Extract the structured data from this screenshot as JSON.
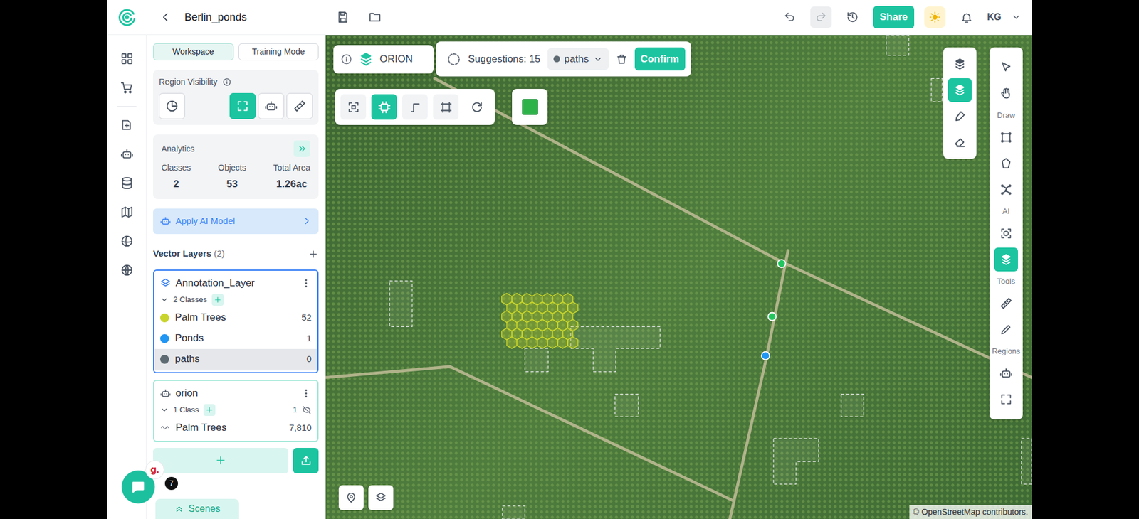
{
  "app": {
    "title": "Berlin_ponds",
    "user": "KG"
  },
  "history": {
    "undo": {
      "disabled": false
    },
    "redo": {
      "disabled": true
    }
  },
  "share": {
    "label": "Share"
  },
  "modes": [
    {
      "label": "Workspace",
      "selected": true
    },
    {
      "label": "Training Mode",
      "selected": false
    }
  ],
  "region_visibility": {
    "title": "Region Visibility",
    "buttons": [
      {
        "selected": false
      },
      {
        "selected": true
      },
      {
        "selected": false
      },
      {
        "selected": false
      }
    ]
  },
  "analytics": {
    "title": "Analytics",
    "stats": [
      {
        "label": "Classes",
        "value": "2"
      },
      {
        "label": "Objects",
        "value": "53"
      },
      {
        "label": "Total Area",
        "value": "1.26ac"
      }
    ]
  },
  "apply_model": {
    "label": "Apply AI Model"
  },
  "vector_layers": {
    "title": "Vector Layers",
    "count": "(2)",
    "layers": [
      {
        "name": "Annotation_Layer",
        "kind": "annotation",
        "selected": true,
        "classes_label": "2 Classes",
        "expanded": true,
        "classes": [
          {
            "name": "Palm Trees",
            "count": "52",
            "color": "#c8d42b",
            "selected": false
          },
          {
            "name": "Ponds",
            "count": "1",
            "color": "#2196f3",
            "selected": false
          },
          {
            "name": "paths",
            "count": "0",
            "color": "#5f6b73",
            "selected": true
          }
        ]
      },
      {
        "name": "orion",
        "kind": "model",
        "selected": false,
        "classes_label": "1 Class",
        "expanded": true,
        "visible_count": "1",
        "hidden": true,
        "classes": [
          {
            "name": "Palm Trees",
            "count": "7,810",
            "selected": false
          }
        ]
      }
    ]
  },
  "chat": {
    "logo": "g.",
    "unread": "7"
  },
  "scenes": {
    "label": "Scenes"
  },
  "map": {
    "orion": {
      "label": "ORION"
    },
    "suggestions": {
      "label": "Suggestions: 15",
      "class_name": "paths",
      "class_color": "#5f6b73",
      "confirm": "Confirm"
    },
    "tools": [
      {
        "selected": false
      },
      {
        "selected": true
      },
      {
        "selected": false
      },
      {
        "selected": false
      },
      {
        "selected": false
      }
    ],
    "swatch": {
      "color": "#2db24a"
    },
    "mini_tools": [
      {
        "selected": false
      },
      {
        "selected": true
      },
      {
        "selected": false
      },
      {
        "selected": false
      }
    ],
    "toolbar_top": [
      {
        "selected": false
      },
      {
        "selected": false
      }
    ],
    "toolbar_sections": [
      {
        "label": "Draw",
        "tools": [
          {
            "selected": false
          },
          {
            "selected": false
          },
          {
            "selected": false
          }
        ]
      },
      {
        "label": "AI",
        "tools": [
          {
            "selected": false
          },
          {
            "selected": true
          }
        ]
      },
      {
        "label": "Tools",
        "tools": [
          {
            "selected": false
          },
          {
            "selected": false
          }
        ]
      },
      {
        "label": "Regions",
        "tools": [
          {
            "selected": false
          },
          {
            "selected": false
          }
        ]
      }
    ],
    "vertices": [
      {
        "color": "#22c55e"
      },
      {
        "color": "#22c55e"
      },
      {
        "color": "#2196f3"
      }
    ],
    "attribution": "© OpenStreetMap contributors."
  }
}
